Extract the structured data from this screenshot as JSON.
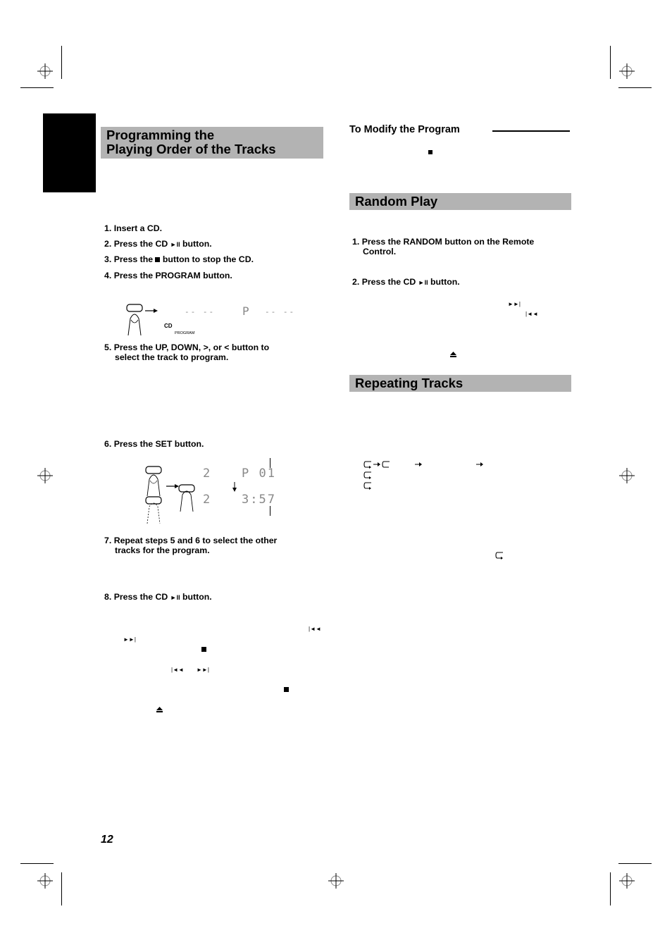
{
  "page": {
    "number": "12"
  },
  "left_column": {
    "section_title_line1": "Programming the",
    "section_title_line2": "Playing Order of the Tracks",
    "steps": [
      {
        "num": "1.",
        "text": "Insert a CD."
      },
      {
        "num": "2.",
        "text_before": "Press the CD ",
        "symbol": "play-pause",
        "text_after": " button."
      },
      {
        "num": "3.",
        "text_before": "Press the ",
        "symbol": "stop",
        "text_after": " button to stop the CD."
      },
      {
        "num": "4.",
        "text": "Press the PROGRAM button."
      },
      {
        "num": "5.",
        "line1": "Press the UP, DOWN, >, or < button to",
        "line2": "select the track to program."
      },
      {
        "num": "6.",
        "text": "Press the SET button."
      },
      {
        "num": "7.",
        "line1": "Repeat steps 5 and 6 to select the other",
        "line2": "tracks for the program."
      },
      {
        "num": "8.",
        "text_before": "Press the CD ",
        "symbol": "play-pause",
        "text_after": " button."
      }
    ],
    "figure_program": {
      "display_before": "-- --",
      "display_after_prefix": "P",
      "display_after": "-- --",
      "label_cd": "CD",
      "label_program": "PROGRAM"
    },
    "figure_set": {
      "track_top": "2",
      "display_top": "P 01",
      "track_bottom": "2",
      "display_bottom": "3:57"
    },
    "icons": {
      "play_pause": "►II",
      "stop": "■",
      "prev": "|◄◄",
      "next": "►►|",
      "eject": "⏏"
    }
  },
  "right_column": {
    "modify_heading": "To Modify the Program",
    "random_title": "Random Play",
    "random_steps": [
      {
        "num": "1.",
        "line1": "Press the RANDOM button on the Remote",
        "line2": "Control."
      },
      {
        "num": "2.",
        "text_before": "Press the CD ",
        "symbol": "play-pause",
        "text_after": " button."
      }
    ],
    "repeat_title": "Repeating Tracks",
    "repeat_icons": {
      "repeat": "repeat-icon",
      "arrow": "→"
    }
  }
}
